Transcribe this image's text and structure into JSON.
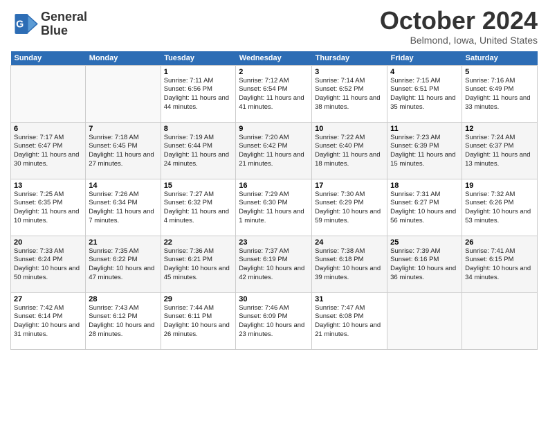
{
  "header": {
    "logo_line1": "General",
    "logo_line2": "Blue",
    "month": "October 2024",
    "location": "Belmond, Iowa, United States"
  },
  "weekdays": [
    "Sunday",
    "Monday",
    "Tuesday",
    "Wednesday",
    "Thursday",
    "Friday",
    "Saturday"
  ],
  "weeks": [
    [
      {
        "day": "",
        "sunrise": "",
        "sunset": "",
        "daylight": ""
      },
      {
        "day": "",
        "sunrise": "",
        "sunset": "",
        "daylight": ""
      },
      {
        "day": "1",
        "sunrise": "Sunrise: 7:11 AM",
        "sunset": "Sunset: 6:56 PM",
        "daylight": "Daylight: 11 hours and 44 minutes."
      },
      {
        "day": "2",
        "sunrise": "Sunrise: 7:12 AM",
        "sunset": "Sunset: 6:54 PM",
        "daylight": "Daylight: 11 hours and 41 minutes."
      },
      {
        "day": "3",
        "sunrise": "Sunrise: 7:14 AM",
        "sunset": "Sunset: 6:52 PM",
        "daylight": "Daylight: 11 hours and 38 minutes."
      },
      {
        "day": "4",
        "sunrise": "Sunrise: 7:15 AM",
        "sunset": "Sunset: 6:51 PM",
        "daylight": "Daylight: 11 hours and 35 minutes."
      },
      {
        "day": "5",
        "sunrise": "Sunrise: 7:16 AM",
        "sunset": "Sunset: 6:49 PM",
        "daylight": "Daylight: 11 hours and 33 minutes."
      }
    ],
    [
      {
        "day": "6",
        "sunrise": "Sunrise: 7:17 AM",
        "sunset": "Sunset: 6:47 PM",
        "daylight": "Daylight: 11 hours and 30 minutes."
      },
      {
        "day": "7",
        "sunrise": "Sunrise: 7:18 AM",
        "sunset": "Sunset: 6:45 PM",
        "daylight": "Daylight: 11 hours and 27 minutes."
      },
      {
        "day": "8",
        "sunrise": "Sunrise: 7:19 AM",
        "sunset": "Sunset: 6:44 PM",
        "daylight": "Daylight: 11 hours and 24 minutes."
      },
      {
        "day": "9",
        "sunrise": "Sunrise: 7:20 AM",
        "sunset": "Sunset: 6:42 PM",
        "daylight": "Daylight: 11 hours and 21 minutes."
      },
      {
        "day": "10",
        "sunrise": "Sunrise: 7:22 AM",
        "sunset": "Sunset: 6:40 PM",
        "daylight": "Daylight: 11 hours and 18 minutes."
      },
      {
        "day": "11",
        "sunrise": "Sunrise: 7:23 AM",
        "sunset": "Sunset: 6:39 PM",
        "daylight": "Daylight: 11 hours and 15 minutes."
      },
      {
        "day": "12",
        "sunrise": "Sunrise: 7:24 AM",
        "sunset": "Sunset: 6:37 PM",
        "daylight": "Daylight: 11 hours and 13 minutes."
      }
    ],
    [
      {
        "day": "13",
        "sunrise": "Sunrise: 7:25 AM",
        "sunset": "Sunset: 6:35 PM",
        "daylight": "Daylight: 11 hours and 10 minutes."
      },
      {
        "day": "14",
        "sunrise": "Sunrise: 7:26 AM",
        "sunset": "Sunset: 6:34 PM",
        "daylight": "Daylight: 11 hours and 7 minutes."
      },
      {
        "day": "15",
        "sunrise": "Sunrise: 7:27 AM",
        "sunset": "Sunset: 6:32 PM",
        "daylight": "Daylight: 11 hours and 4 minutes."
      },
      {
        "day": "16",
        "sunrise": "Sunrise: 7:29 AM",
        "sunset": "Sunset: 6:30 PM",
        "daylight": "Daylight: 11 hours and 1 minute."
      },
      {
        "day": "17",
        "sunrise": "Sunrise: 7:30 AM",
        "sunset": "Sunset: 6:29 PM",
        "daylight": "Daylight: 10 hours and 59 minutes."
      },
      {
        "day": "18",
        "sunrise": "Sunrise: 7:31 AM",
        "sunset": "Sunset: 6:27 PM",
        "daylight": "Daylight: 10 hours and 56 minutes."
      },
      {
        "day": "19",
        "sunrise": "Sunrise: 7:32 AM",
        "sunset": "Sunset: 6:26 PM",
        "daylight": "Daylight: 10 hours and 53 minutes."
      }
    ],
    [
      {
        "day": "20",
        "sunrise": "Sunrise: 7:33 AM",
        "sunset": "Sunset: 6:24 PM",
        "daylight": "Daylight: 10 hours and 50 minutes."
      },
      {
        "day": "21",
        "sunrise": "Sunrise: 7:35 AM",
        "sunset": "Sunset: 6:22 PM",
        "daylight": "Daylight: 10 hours and 47 minutes."
      },
      {
        "day": "22",
        "sunrise": "Sunrise: 7:36 AM",
        "sunset": "Sunset: 6:21 PM",
        "daylight": "Daylight: 10 hours and 45 minutes."
      },
      {
        "day": "23",
        "sunrise": "Sunrise: 7:37 AM",
        "sunset": "Sunset: 6:19 PM",
        "daylight": "Daylight: 10 hours and 42 minutes."
      },
      {
        "day": "24",
        "sunrise": "Sunrise: 7:38 AM",
        "sunset": "Sunset: 6:18 PM",
        "daylight": "Daylight: 10 hours and 39 minutes."
      },
      {
        "day": "25",
        "sunrise": "Sunrise: 7:39 AM",
        "sunset": "Sunset: 6:16 PM",
        "daylight": "Daylight: 10 hours and 36 minutes."
      },
      {
        "day": "26",
        "sunrise": "Sunrise: 7:41 AM",
        "sunset": "Sunset: 6:15 PM",
        "daylight": "Daylight: 10 hours and 34 minutes."
      }
    ],
    [
      {
        "day": "27",
        "sunrise": "Sunrise: 7:42 AM",
        "sunset": "Sunset: 6:14 PM",
        "daylight": "Daylight: 10 hours and 31 minutes."
      },
      {
        "day": "28",
        "sunrise": "Sunrise: 7:43 AM",
        "sunset": "Sunset: 6:12 PM",
        "daylight": "Daylight: 10 hours and 28 minutes."
      },
      {
        "day": "29",
        "sunrise": "Sunrise: 7:44 AM",
        "sunset": "Sunset: 6:11 PM",
        "daylight": "Daylight: 10 hours and 26 minutes."
      },
      {
        "day": "30",
        "sunrise": "Sunrise: 7:46 AM",
        "sunset": "Sunset: 6:09 PM",
        "daylight": "Daylight: 10 hours and 23 minutes."
      },
      {
        "day": "31",
        "sunrise": "Sunrise: 7:47 AM",
        "sunset": "Sunset: 6:08 PM",
        "daylight": "Daylight: 10 hours and 21 minutes."
      },
      {
        "day": "",
        "sunrise": "",
        "sunset": "",
        "daylight": ""
      },
      {
        "day": "",
        "sunrise": "",
        "sunset": "",
        "daylight": ""
      }
    ]
  ]
}
